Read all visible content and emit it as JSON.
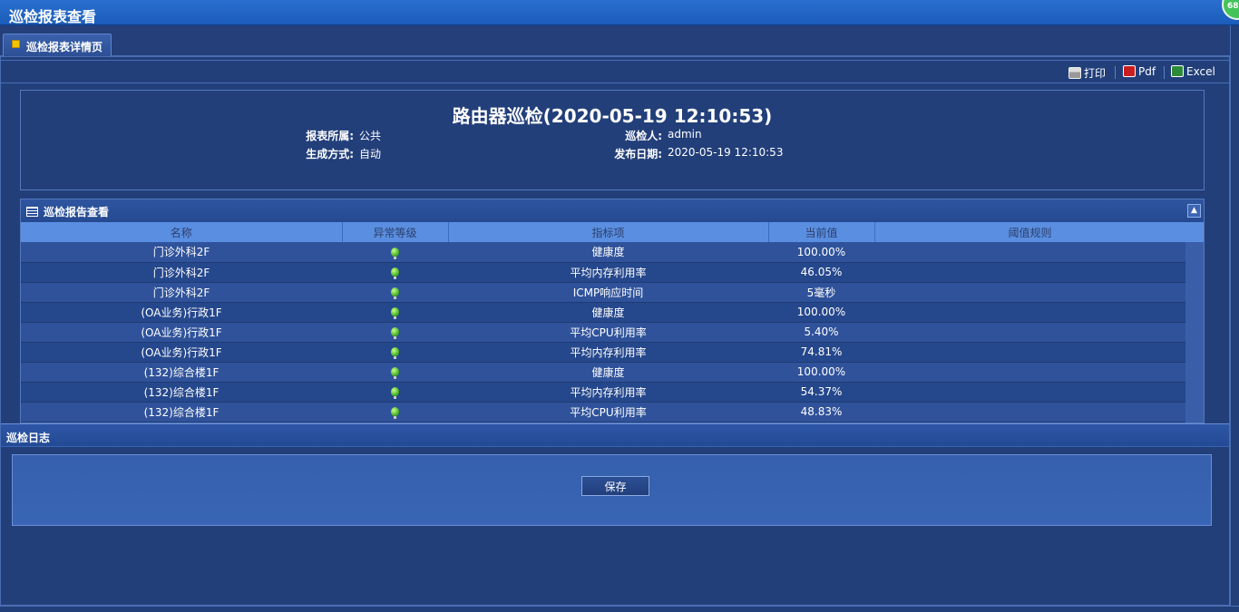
{
  "app": {
    "title": "巡检报表查看",
    "corner_badge": "68"
  },
  "tab": {
    "label": "巡检报表详情页"
  },
  "toolbar": {
    "print_label": "打印",
    "pdf_label": "Pdf",
    "excel_label": "Excel"
  },
  "report": {
    "title": "路由器巡检(2020-05-19 12:10:53)",
    "owner_label": "报表所属:",
    "owner_value": "公共",
    "inspector_label": "巡检人:",
    "inspector_value": "admin",
    "method_label": "生成方式:",
    "method_value": "自动",
    "publish_label": "发布日期:",
    "publish_value": "2020-05-19 12:10:53"
  },
  "grid": {
    "title": "巡检报告查看",
    "columns": [
      "名称",
      "异常等级",
      "指标项",
      "当前值",
      "阈值规则"
    ],
    "rows": [
      {
        "name": "门诊外科2F",
        "level": "normal",
        "metric": "健康度",
        "value": "100.00%",
        "rule": ""
      },
      {
        "name": "门诊外科2F",
        "level": "normal",
        "metric": "平均内存利用率",
        "value": "46.05%",
        "rule": ""
      },
      {
        "name": "门诊外科2F",
        "level": "normal",
        "metric": "ICMP响应时间",
        "value": "5毫秒",
        "rule": ""
      },
      {
        "name": "(OA业务)行政1F",
        "level": "normal",
        "metric": "健康度",
        "value": "100.00%",
        "rule": ""
      },
      {
        "name": "(OA业务)行政1F",
        "level": "normal",
        "metric": "平均CPU利用率",
        "value": "5.40%",
        "rule": ""
      },
      {
        "name": "(OA业务)行政1F",
        "level": "normal",
        "metric": "平均内存利用率",
        "value": "74.81%",
        "rule": ""
      },
      {
        "name": "(132)综合楼1F",
        "level": "normal",
        "metric": "健康度",
        "value": "100.00%",
        "rule": ""
      },
      {
        "name": "(132)综合楼1F",
        "level": "normal",
        "metric": "平均内存利用率",
        "value": "54.37%",
        "rule": ""
      },
      {
        "name": "(132)综合楼1F",
        "level": "normal",
        "metric": "平均CPU利用率",
        "value": "48.83%",
        "rule": ""
      }
    ]
  },
  "log": {
    "title": "巡检日志",
    "value": ""
  },
  "save_label": "保存",
  "colors": {
    "accent": "#1b5cb9",
    "panel": "#223f7a",
    "header_row": "#5a8ee0",
    "status_normal": "#3da81c"
  }
}
